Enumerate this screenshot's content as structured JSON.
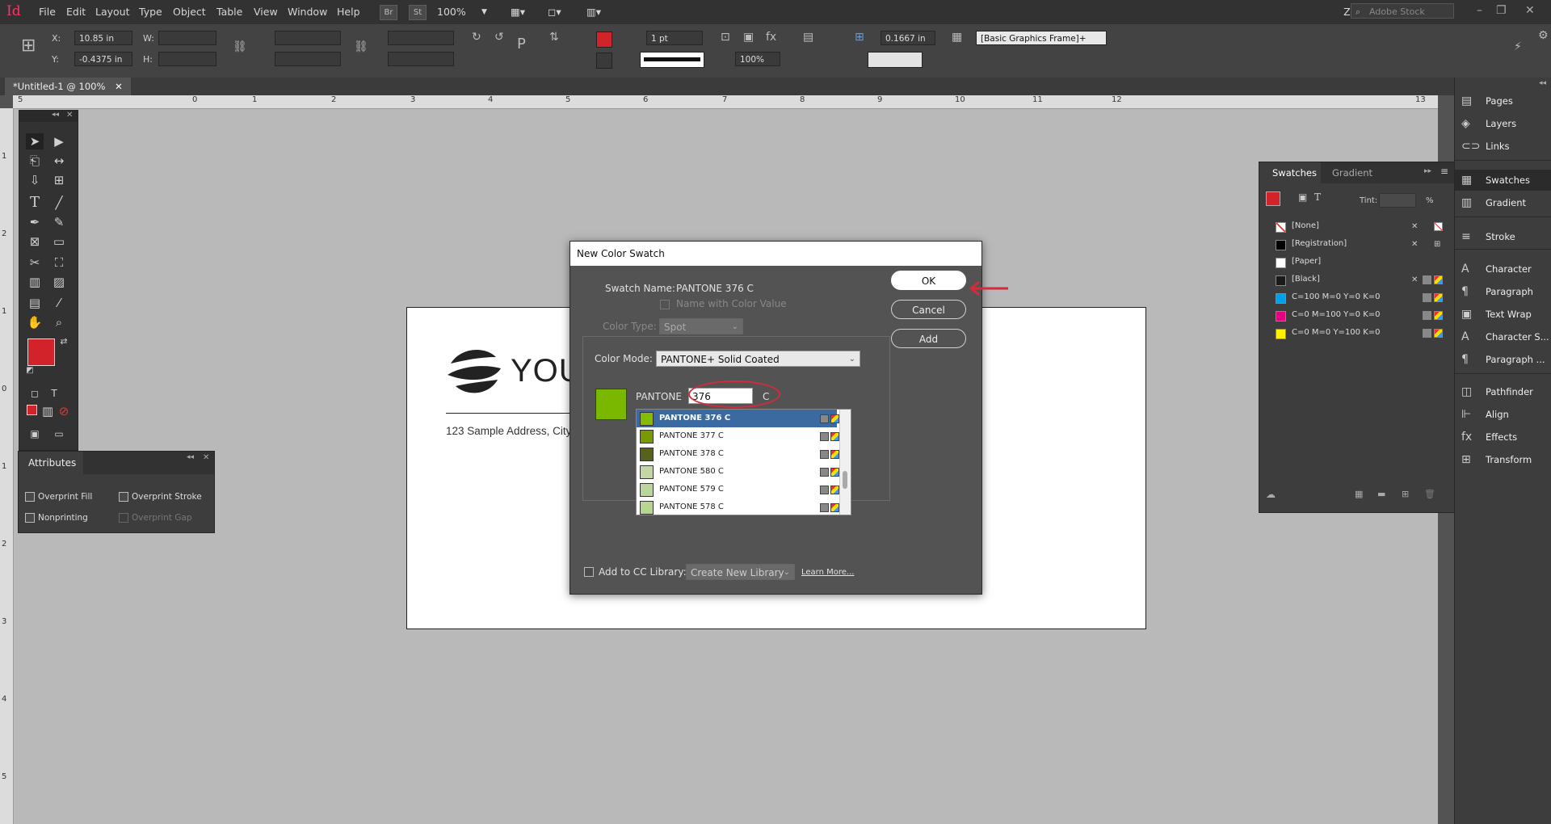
{
  "app": {
    "logo": "Id",
    "menu": [
      "File",
      "Edit",
      "Layout",
      "Type",
      "Object",
      "Table",
      "View",
      "Window",
      "Help"
    ],
    "bridge": "Br",
    "stock": "St",
    "zoom": "100%",
    "user": "Zoran",
    "search_placeholder": "Adobe Stock"
  },
  "control": {
    "x_label": "X:",
    "x_value": "10.85 in",
    "y_label": "Y:",
    "y_value": "-0.4375 in",
    "w_label": "W:",
    "h_label": "H:",
    "stroke_weight": "1 pt",
    "scale": "100%",
    "offset": "0.1667 in",
    "object_style": "[Basic Graphics Frame]+",
    "fill_color": "#d2232a"
  },
  "tab": {
    "title": "*Untitled-1 @ 100%",
    "close": "✕"
  },
  "ruler": {
    "top": [
      "5",
      "0",
      "1",
      "2",
      "3",
      "4",
      "5",
      "6",
      "7",
      "8",
      "9",
      "10",
      "11",
      "12",
      "13"
    ],
    "left": [
      "1",
      "2",
      "1",
      "0",
      "1",
      "2",
      "3",
      "4",
      "5"
    ]
  },
  "document": {
    "brand": "YOUR",
    "address": "123 Sample Address, City"
  },
  "attributes_panel": {
    "title": "Attributes",
    "overprint_fill": "Overprint Fill",
    "overprint_stroke": "Overprint Stroke",
    "nonprinting": "Nonprinting",
    "overprint_gap": "Overprint Gap"
  },
  "dialog": {
    "title": "New Color Swatch",
    "swatch_name_label": "Swatch Name:",
    "swatch_name_value": "PANTONE 376 C",
    "name_with_color_value": "Name with Color Value",
    "color_type_label": "Color Type:",
    "color_type_value": "Spot",
    "color_mode_label": "Color Mode:",
    "color_mode_value": "PANTONE+ Solid Coated",
    "pantone_prefix": "PANTONE",
    "pantone_input": "376",
    "pantone_suffix": "C",
    "preview_color": "#7ab800",
    "ok": "OK",
    "cancel": "Cancel",
    "add": "Add",
    "add_to_cc": "Add to CC Library:",
    "cc_library_value": "Create New Library",
    "learn_more": "Learn More...",
    "swatches": [
      {
        "name": "PANTONE 376 C",
        "color": "#84bd00",
        "selected": true
      },
      {
        "name": "PANTONE 377 C",
        "color": "#7a9a01",
        "selected": false
      },
      {
        "name": "PANTONE 378 C",
        "color": "#59621d",
        "selected": false
      },
      {
        "name": "PANTONE 580 C",
        "color": "#c4d6a4",
        "selected": false
      },
      {
        "name": "PANTONE 579 C",
        "color": "#bcd59a",
        "selected": false
      },
      {
        "name": "PANTONE 578 C",
        "color": "#b7d490",
        "selected": false
      }
    ]
  },
  "swatches_panel": {
    "tab_swatches": "Swatches",
    "tab_gradient": "Gradient",
    "tint_label": "Tint:",
    "tint_unit": "%",
    "rows": [
      {
        "name": "[None]",
        "color": "#ffffff"
      },
      {
        "name": "[Registration]",
        "color": "#000000"
      },
      {
        "name": "[Paper]",
        "color": "#ffffff"
      },
      {
        "name": "[Black]",
        "color": "#1a1a1a"
      },
      {
        "name": "C=100 M=0 Y=0 K=0",
        "color": "#00a0e9"
      },
      {
        "name": "C=0 M=100 Y=0 K=0",
        "color": "#e4007f"
      },
      {
        "name": "C=0 M=0 Y=100 K=0",
        "color": "#fff100"
      }
    ]
  },
  "dock": [
    {
      "label": "Pages",
      "icon": "pages-icon",
      "glyph": "▤"
    },
    {
      "label": "Layers",
      "icon": "layers-icon",
      "glyph": "◈"
    },
    {
      "label": "Links",
      "icon": "links-icon",
      "glyph": "⊂⊃"
    },
    {
      "label": "Swatches",
      "icon": "swatches-icon",
      "glyph": "▦"
    },
    {
      "label": "Gradient",
      "icon": "gradient-icon",
      "glyph": "▥"
    },
    {
      "label": "Stroke",
      "icon": "stroke-icon",
      "glyph": "≡"
    },
    {
      "label": "Character",
      "icon": "character-icon",
      "glyph": "A"
    },
    {
      "label": "Paragraph",
      "icon": "paragraph-icon",
      "glyph": "¶"
    },
    {
      "label": "Text Wrap",
      "icon": "text-wrap-icon",
      "glyph": "▣"
    },
    {
      "label": "Character S...",
      "icon": "character-styles-icon",
      "glyph": "A"
    },
    {
      "label": "Paragraph ...",
      "icon": "paragraph-styles-icon",
      "glyph": "¶"
    },
    {
      "label": "Pathfinder",
      "icon": "pathfinder-icon",
      "glyph": "◫"
    },
    {
      "label": "Align",
      "icon": "align-icon",
      "glyph": "⊩"
    },
    {
      "label": "Effects",
      "icon": "effects-icon",
      "glyph": "fx"
    },
    {
      "label": "Transform",
      "icon": "transform-icon",
      "glyph": "⊞"
    }
  ]
}
